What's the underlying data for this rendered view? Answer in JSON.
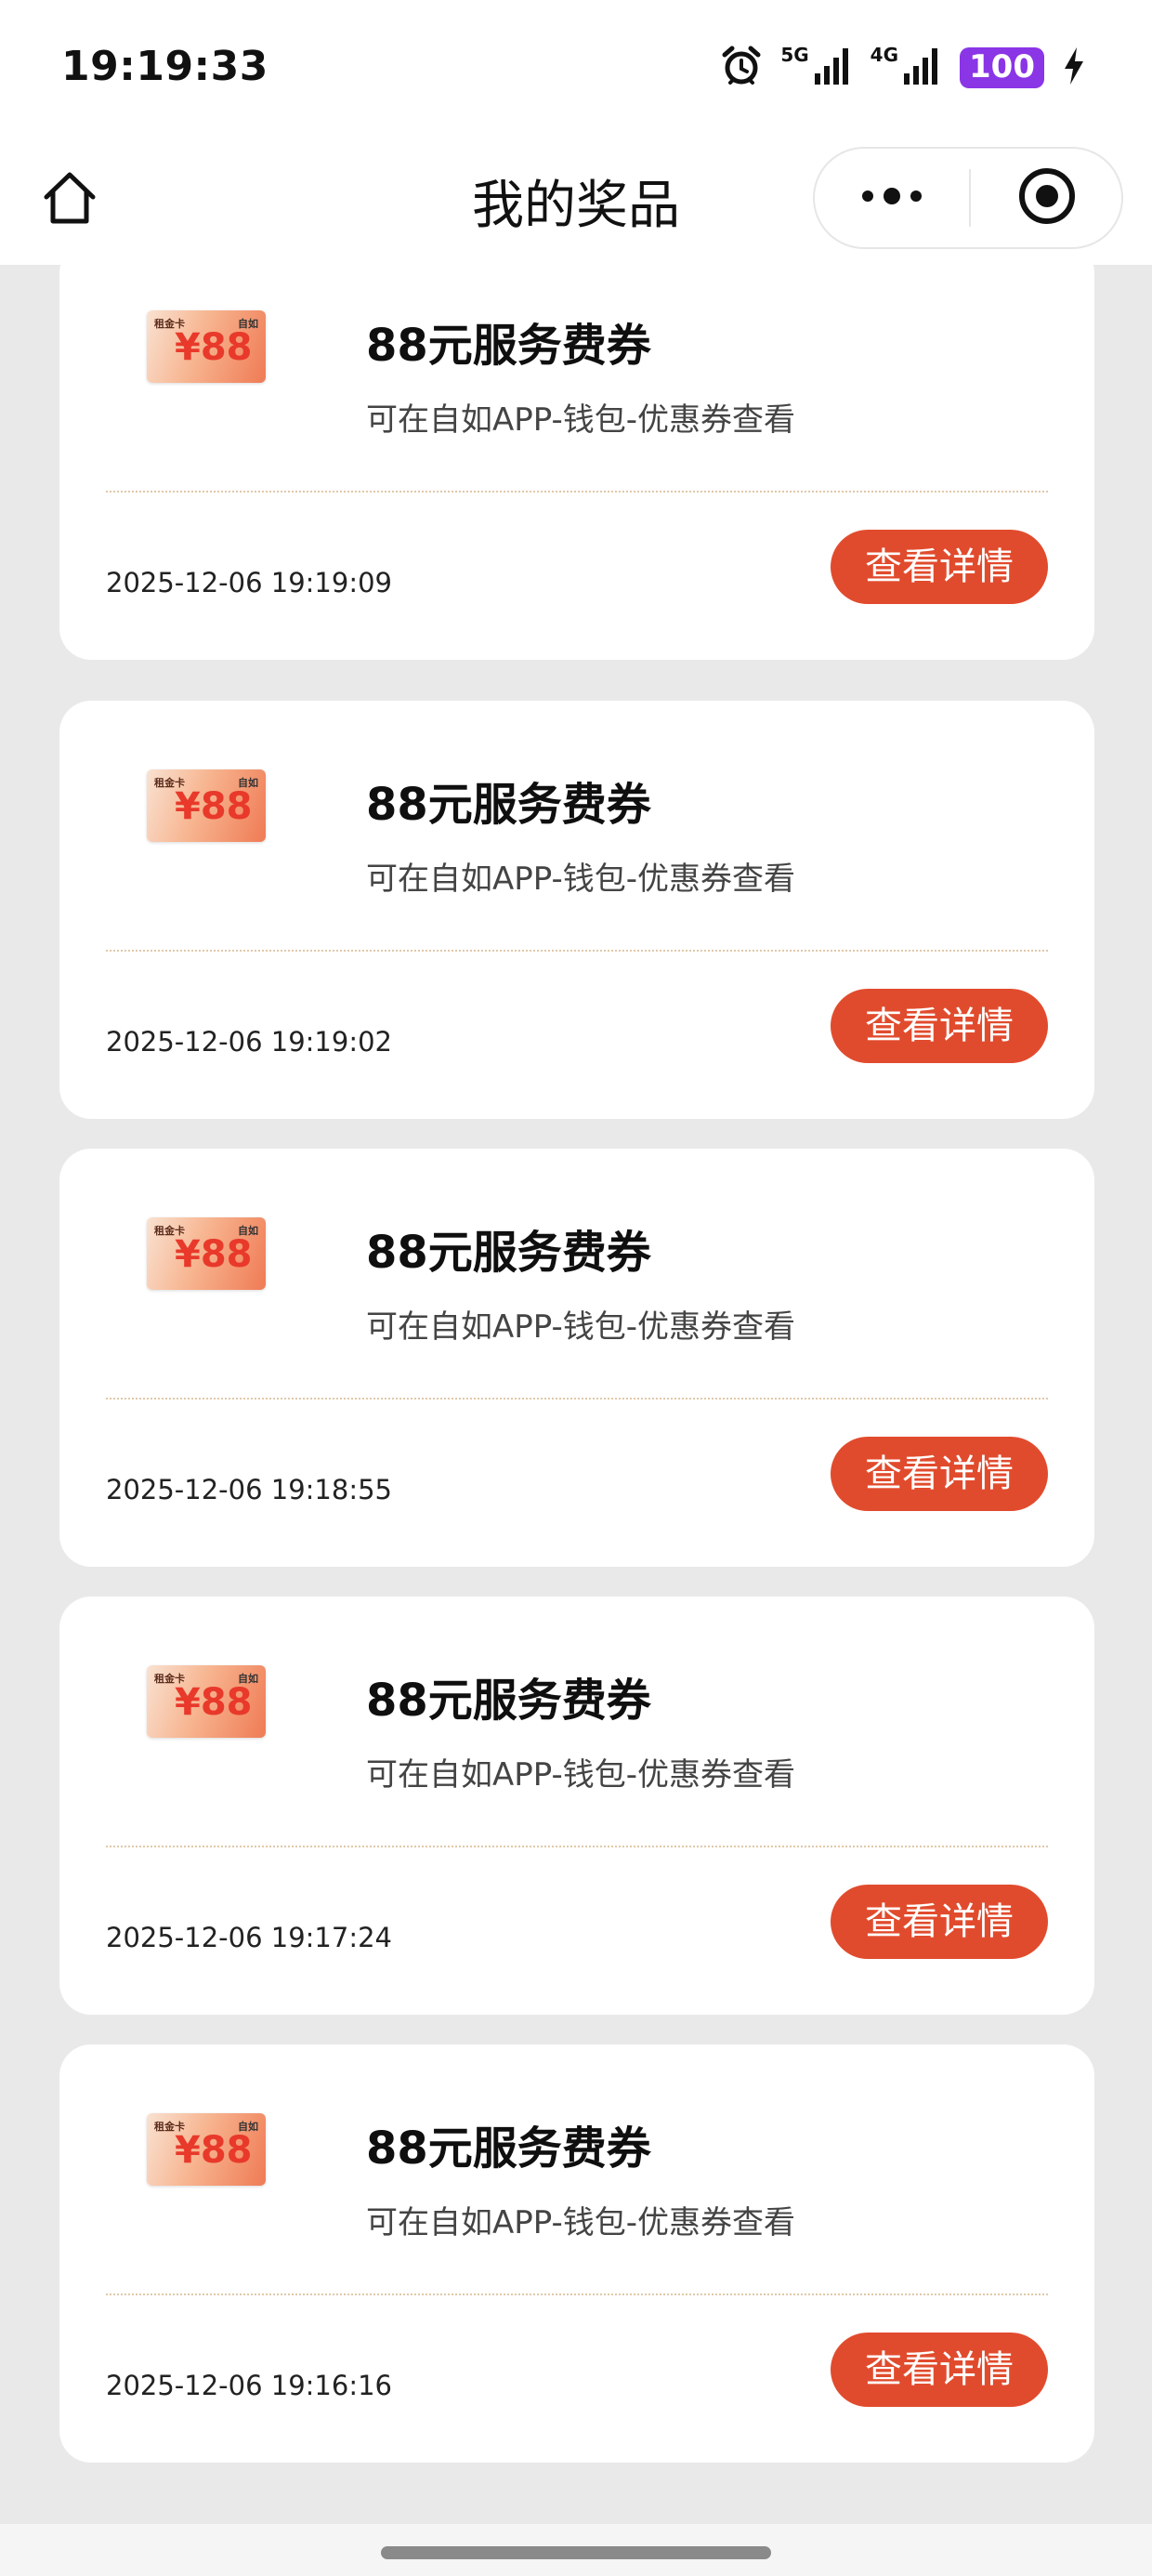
{
  "status_bar": {
    "time": "19:19:33",
    "network_1": "5G",
    "network_2": "4G",
    "battery": "100",
    "battery_color": "#8a35e6"
  },
  "header": {
    "title": "我的奖品"
  },
  "prizes": [
    {
      "thumb_label": "租金卡",
      "thumb_brand": "自如",
      "thumb_amount": "¥88",
      "title": "88元服务费券",
      "desc": "可在自如APP-钱包-优惠券查看",
      "date": "2025-12-06 19:19:09",
      "button": "查看详情"
    },
    {
      "thumb_label": "租金卡",
      "thumb_brand": "自如",
      "thumb_amount": "¥88",
      "title": "88元服务费券",
      "desc": "可在自如APP-钱包-优惠券查看",
      "date": "2025-12-06 19:19:02",
      "button": "查看详情"
    },
    {
      "thumb_label": "租金卡",
      "thumb_brand": "自如",
      "thumb_amount": "¥88",
      "title": "88元服务费券",
      "desc": "可在自如APP-钱包-优惠券查看",
      "date": "2025-12-06 19:18:55",
      "button": "查看详情"
    },
    {
      "thumb_label": "租金卡",
      "thumb_brand": "自如",
      "thumb_amount": "¥88",
      "title": "88元服务费券",
      "desc": "可在自如APP-钱包-优惠券查看",
      "date": "2025-12-06 19:17:24",
      "button": "查看详情"
    },
    {
      "thumb_label": "租金卡",
      "thumb_brand": "自如",
      "thumb_amount": "¥88",
      "title": "88元服务费券",
      "desc": "可在自如APP-钱包-优惠券查看",
      "date": "2025-12-06 19:16:16",
      "button": "查看详情"
    }
  ],
  "colors": {
    "accent": "#e14b2d",
    "page_background": "#e9e9e9"
  },
  "icons": {
    "back": "home-icon",
    "more": "more-dots-icon",
    "close": "close-target-icon"
  }
}
